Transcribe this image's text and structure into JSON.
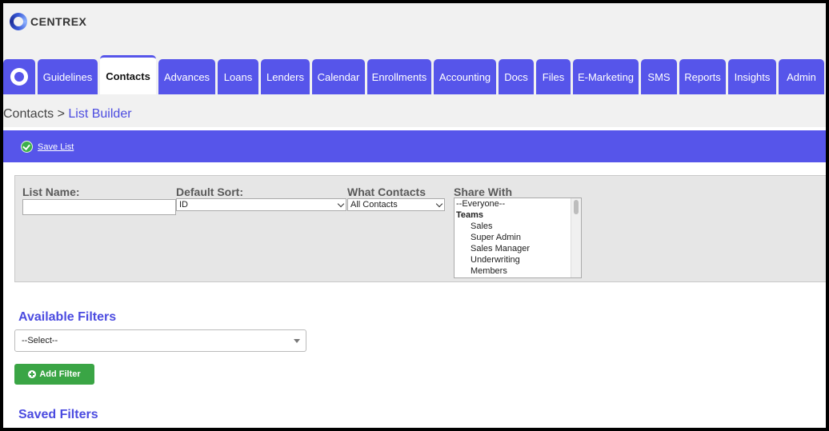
{
  "app": {
    "logo_text": "CENTREX"
  },
  "nav": {
    "items": [
      {
        "label": "Guidelines"
      },
      {
        "label": "Contacts"
      },
      {
        "label": "Advances"
      },
      {
        "label": "Loans"
      },
      {
        "label": "Lenders"
      },
      {
        "label": "Calendar"
      },
      {
        "label": "Enrollments"
      },
      {
        "label": "Accounting"
      },
      {
        "label": "Docs"
      },
      {
        "label": "Files"
      },
      {
        "label": "E-Marketing"
      },
      {
        "label": "SMS"
      },
      {
        "label": "Reports"
      },
      {
        "label": "Insights"
      },
      {
        "label": "Admin"
      }
    ],
    "active": "Contacts"
  },
  "breadcrumb": {
    "parent": "Contacts",
    "separator": ">",
    "current": "List Builder"
  },
  "actions": {
    "save_label": "Save List"
  },
  "form": {
    "list_name_label": "List Name:",
    "list_name_value": "",
    "default_sort_label": "Default Sort:",
    "default_sort_value": "ID",
    "what_contacts_label": "What Contacts",
    "what_contacts_value": "All Contacts",
    "share_with_label": "Share With",
    "share_options": [
      "--Everyone--",
      "Teams",
      "Sales",
      "Super Admin",
      "Sales Manager",
      "Underwriting",
      "Members"
    ]
  },
  "filters": {
    "available_title": "Available Filters",
    "select_value": "--Select--",
    "add_label": "Add Filter",
    "saved_title": "Saved Filters"
  },
  "colors": {
    "accent": "#5655ea",
    "title": "#4b4be0",
    "success": "#3aa545"
  }
}
